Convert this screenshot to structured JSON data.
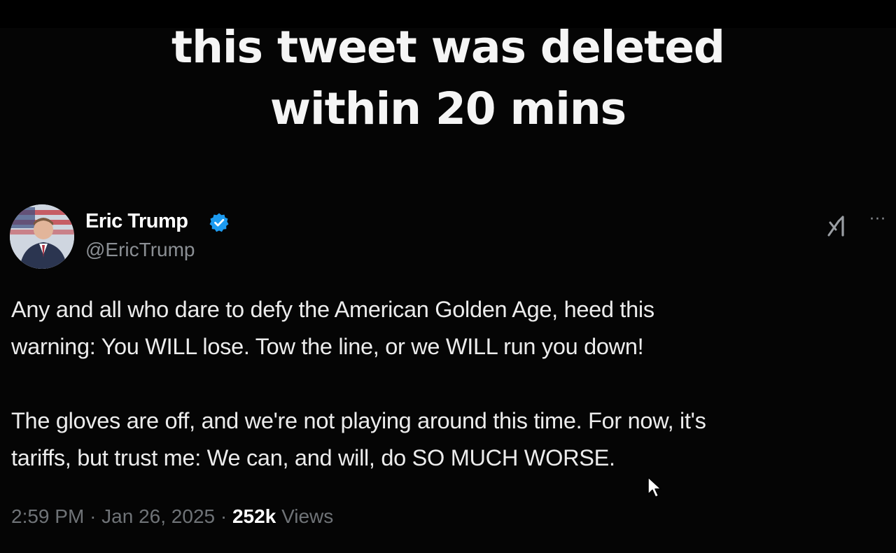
{
  "caption": {
    "line1": "this tweet was deleted",
    "line2": "within 20 mins"
  },
  "tweet": {
    "author": {
      "name": "Eric Trump",
      "handle": "@EricTrump",
      "verified": true,
      "verified_color": "#1d9bf0"
    },
    "body": {
      "paragraph1": [
        "Any and all who dare to defy the American Golden Age, heed this",
        "warning: You WILL lose. Tow the line, or we WILL run you down!"
      ],
      "paragraph2": [
        "The gloves are off, and we're not playing around this time. For now, it's",
        "tariffs, but trust me: We can, and will, do SO MUCH WORSE."
      ]
    },
    "meta": {
      "time": "2:59 PM",
      "separator": "·",
      "date": "Jan 26, 2025",
      "views_count": "252k",
      "views_label": "Views"
    },
    "icons": {
      "grok": "grok-icon",
      "more": "more-options-icon",
      "verified": "verified-badge-icon"
    }
  },
  "colors": {
    "background": "#050505",
    "text": "#ececec",
    "muted": "#8b8f94",
    "accent": "#1d9bf0"
  }
}
